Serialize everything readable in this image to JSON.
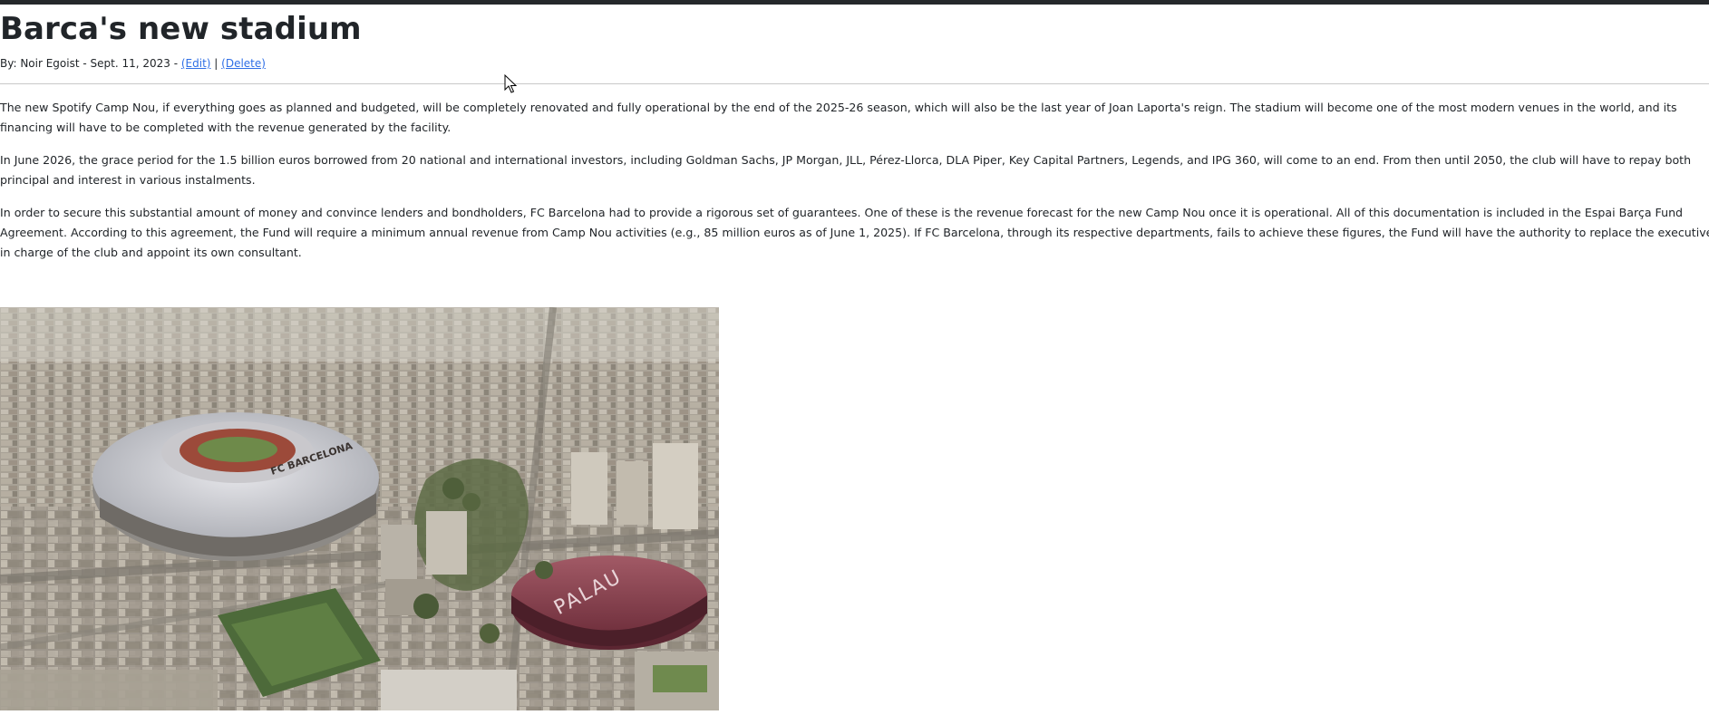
{
  "article": {
    "title": "Barca's new stadium",
    "byline_prefix": "By: Noir Egoist - Sept. 11, 2023 - ",
    "edit_label": "(Edit)",
    "separator": " | ",
    "delete_label": "(Delete)",
    "paragraphs": [
      "The new Spotify Camp Nou, if everything goes as planned and budgeted, will be completely renovated and fully operational by the end of the 2025-26 season, which will also be the last year of Joan Laporta's reign. The stadium will become one of the most modern venues in the world, and its financing will have to be completed with the revenue generated by the facility.",
      "In June 2026, the grace period for the 1.5 billion euros borrowed from 20 national and international investors, including Goldman Sachs, JP Morgan, JLL, Pérez-Llorca, DLA Piper, Key Capital Partners, Legends, and IPG 360, will come to an end. From then until 2050, the club will have to repay both principal and interest in various instalments.",
      "In order to secure this substantial amount of money and convince lenders and bondholders, FC Barcelona had to provide a rigorous set of guarantees. One of these is the revenue forecast for the new Camp Nou once it is operational. All of this documentation is included in the Espai Barça Fund Agreement. According to this agreement, the Fund will require a minimum annual revenue from Camp Nou activities (e.g., 85 million euros as of June 1, 2025). If FC Barcelona, through its respective departments, fails to achieve these figures, the Fund will have the authority to replace the executive in charge of the club and appoint its own consultant."
    ],
    "image": {
      "arena_label": "PALAU",
      "stadium_label": "FC BARCELONA"
    }
  },
  "colors": {
    "link": "#2f6fe6",
    "text": "#212529",
    "topbar": "#25282b"
  }
}
